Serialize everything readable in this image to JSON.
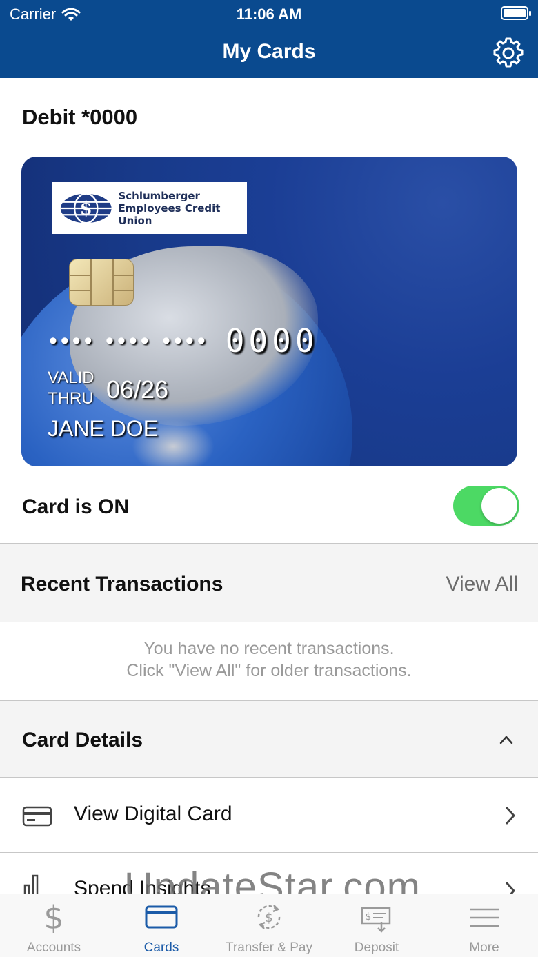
{
  "status_bar": {
    "carrier": "Carrier",
    "time": "11:06 AM"
  },
  "header": {
    "title": "My Cards",
    "settings_icon": "gear-icon"
  },
  "card": {
    "label": "Debit *0000",
    "issuer_logo_text_line1": "Schlumberger",
    "issuer_logo_text_line2": "Employees Credit Union",
    "masked_digits": "•••• •••• ••••",
    "last4": "0000",
    "valid_thru_label": "VALID\nTHRU",
    "expiry": "06/26",
    "holder": "JANE DOE"
  },
  "card_status": {
    "label": "Card is ON",
    "on": true,
    "accent": "#4cd964"
  },
  "recent": {
    "title": "Recent Transactions",
    "view_all": "View All",
    "empty_line1": "You have no recent transactions.",
    "empty_line2": "Click \"View All\" for older transactions."
  },
  "details": {
    "title": "Card Details",
    "items": [
      {
        "label": "View Digital Card",
        "icon": "credit-card-icon"
      },
      {
        "label": "Spend Insights",
        "icon": "bar-chart-icon"
      }
    ]
  },
  "watermark": "UpdateStar.com",
  "tabs": [
    {
      "label": "Accounts",
      "icon": "dollar-icon",
      "active": false
    },
    {
      "label": "Cards",
      "icon": "credit-card-icon",
      "active": true
    },
    {
      "label": "Transfer & Pay",
      "icon": "transfer-icon",
      "active": false
    },
    {
      "label": "Deposit",
      "icon": "check-deposit-icon",
      "active": false
    },
    {
      "label": "More",
      "icon": "menu-icon",
      "active": false
    }
  ],
  "colors": {
    "header_bg": "#0a4a8f",
    "tab_active": "#1b5ba8",
    "tab_inactive": "#9a9a9a"
  }
}
